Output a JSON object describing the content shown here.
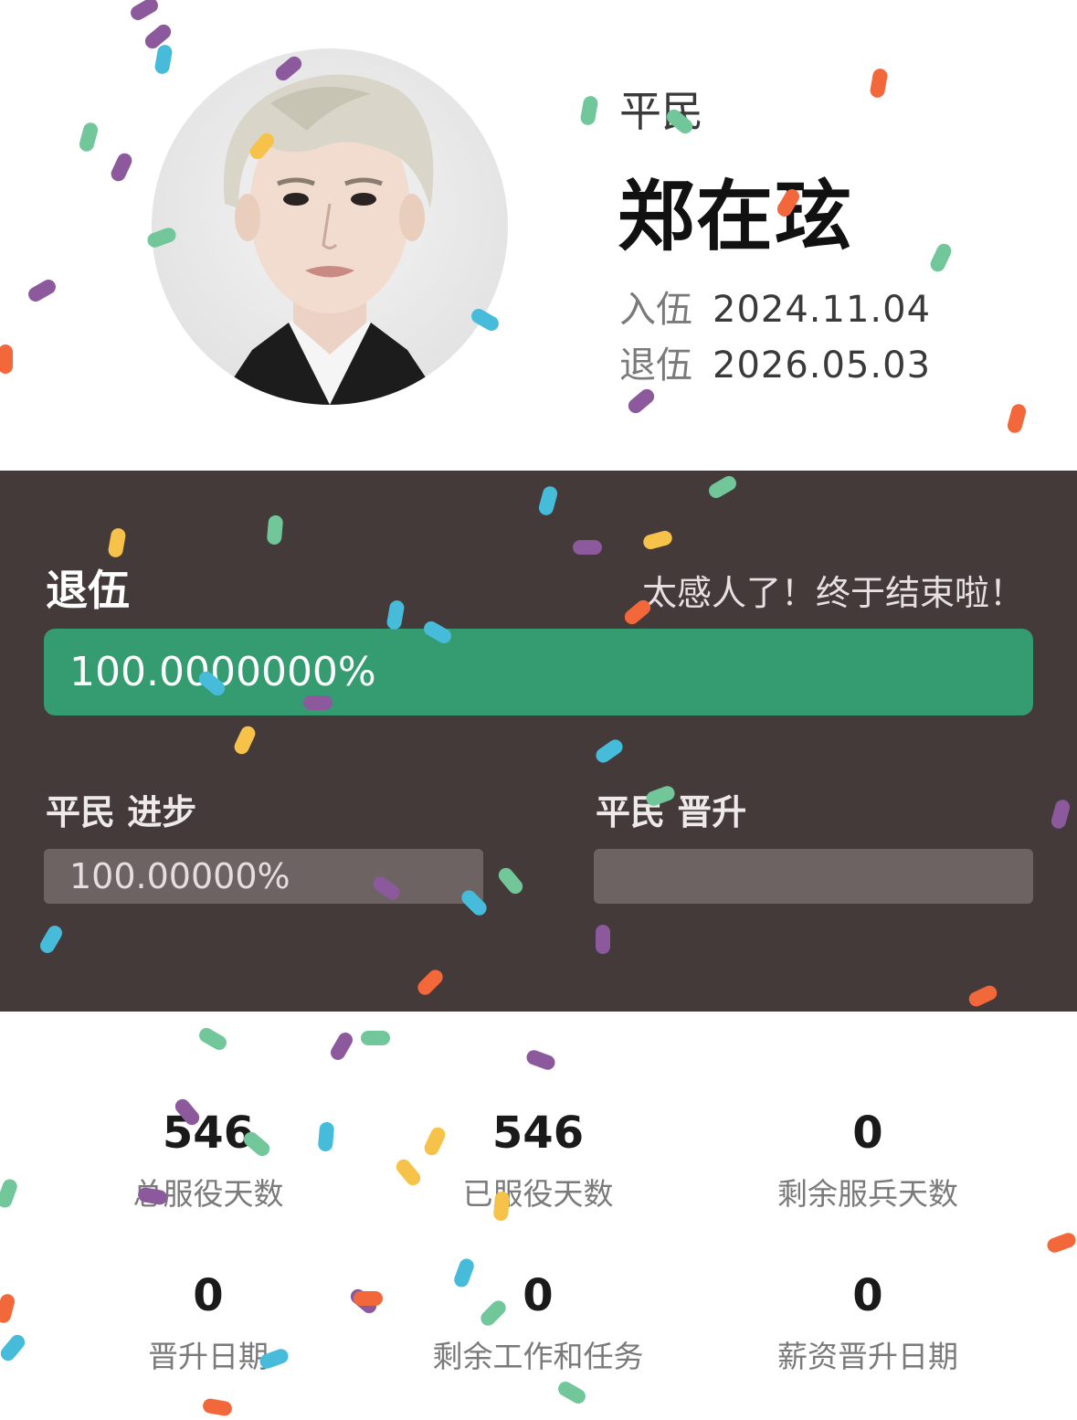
{
  "profile": {
    "rank": "平民",
    "name": "郑在玹",
    "enlist_label": "入伍",
    "enlist_date": "2024.11.04",
    "discharge_label": "退伍",
    "discharge_date": "2026.05.03"
  },
  "panel": {
    "title": "退伍",
    "message": "太感人了！终于结束啦！",
    "progress_text": "100.0000000%",
    "progress_value": 100,
    "progress_color": "#359c71",
    "sub": [
      {
        "label": "平民 进步",
        "text": "100.00000%",
        "value": 100
      },
      {
        "label": "平民 晋升",
        "text": "",
        "value": 0
      }
    ]
  },
  "stats": [
    {
      "value": "546",
      "label": "总服役天数"
    },
    {
      "value": "546",
      "label": "已服役天数"
    },
    {
      "value": "0",
      "label": "剩余服兵天数"
    },
    {
      "value": "0",
      "label": "晋升日期"
    },
    {
      "value": "0",
      "label": "剩余工作和任务"
    },
    {
      "value": "0",
      "label": "薪资晋升日期"
    }
  ],
  "colors": {
    "panel_bg": "#443a3a",
    "confetti": [
      "#8c5a9c",
      "#f2683b",
      "#46bcda",
      "#72c79a",
      "#f7c24a"
    ]
  }
}
